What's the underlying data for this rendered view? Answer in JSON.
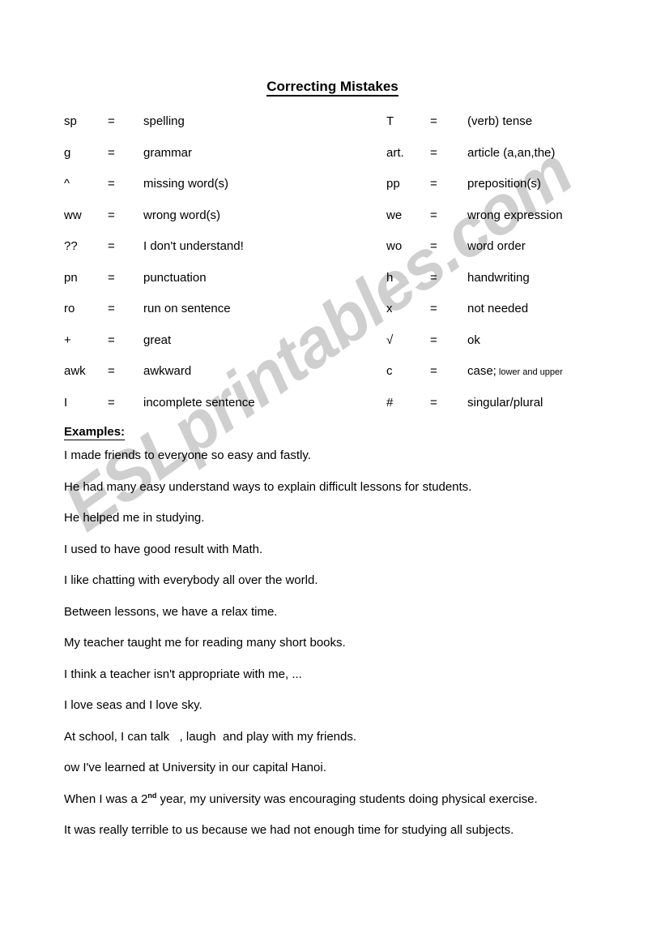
{
  "document": {
    "title": "Correcting Mistakes",
    "watermark": "ESLprintables.com",
    "watermark_color": "#cccccc",
    "background_color": "#ffffff",
    "text_color": "#000000"
  },
  "legend": {
    "left_column": [
      {
        "symbol": "sp",
        "equals": "=",
        "meaning": "spelling"
      },
      {
        "symbol": "g",
        "equals": "=",
        "meaning": "grammar"
      },
      {
        "symbol": "^",
        "equals": "=",
        "meaning": "missing word(s)"
      },
      {
        "symbol": "ww",
        "equals": "=",
        "meaning": "wrong word(s)"
      },
      {
        "symbol": "??",
        "equals": "=",
        "meaning": "I don't understand!"
      },
      {
        "symbol": "pn",
        "equals": "=",
        "meaning": "punctuation"
      },
      {
        "symbol": "ro",
        "equals": "=",
        "meaning": "run on sentence"
      },
      {
        "symbol": "+",
        "equals": "=",
        "meaning": "great"
      },
      {
        "symbol": "awk",
        "equals": "=",
        "meaning": "awkward"
      },
      {
        "symbol": "I",
        "equals": "=",
        "meaning": "incomplete sentence"
      }
    ],
    "right_column": [
      {
        "symbol": "T",
        "equals": "=",
        "meaning": "(verb) tense"
      },
      {
        "symbol": "art.",
        "equals": "=",
        "meaning": "article (a,an,the)"
      },
      {
        "symbol": "pp",
        "equals": "=",
        "meaning": "preposition(s)"
      },
      {
        "symbol": "we",
        "equals": "=",
        "meaning": "wrong expression"
      },
      {
        "symbol": "wo",
        "equals": "=",
        "meaning": "word order"
      },
      {
        "symbol": "h",
        "equals": "=",
        "meaning": "handwriting"
      },
      {
        "symbol": "x",
        "equals": "=",
        "meaning": "not needed"
      },
      {
        "symbol": "√",
        "equals": "=",
        "meaning": "ok"
      },
      {
        "symbol": "c",
        "equals": "=",
        "meaning": "case;",
        "note": " lower and upper"
      },
      {
        "symbol": "#",
        "equals": "=",
        "meaning": "singular/plural"
      }
    ]
  },
  "examples": {
    "heading": "Examples:",
    "lines": [
      "I made friends to everyone so easy and fastly.",
      "He had many easy understand ways to explain difficult lessons for students.",
      "He helped me in studying.",
      "I used to have good result with Math.",
      "I like chatting with everybody all over the world.",
      "Between lessons, we have a relax time.",
      "My teacher taught me for reading many short books.",
      "I think a teacher isn't appropriate with me, ...",
      "I love seas and I love sky.",
      "At school, I can talk   , laugh  and play with my friends.",
      "ow I've learned at University in our capital Hanoi.",
      "It was really terrible to us because we had not enough time for studying all subjects."
    ],
    "superscript_line": {
      "before": "When I was a 2",
      "sup": "nd",
      "after": " year, my university was encouraging students doing physical exercise."
    },
    "superscript_line_index": 11
  }
}
